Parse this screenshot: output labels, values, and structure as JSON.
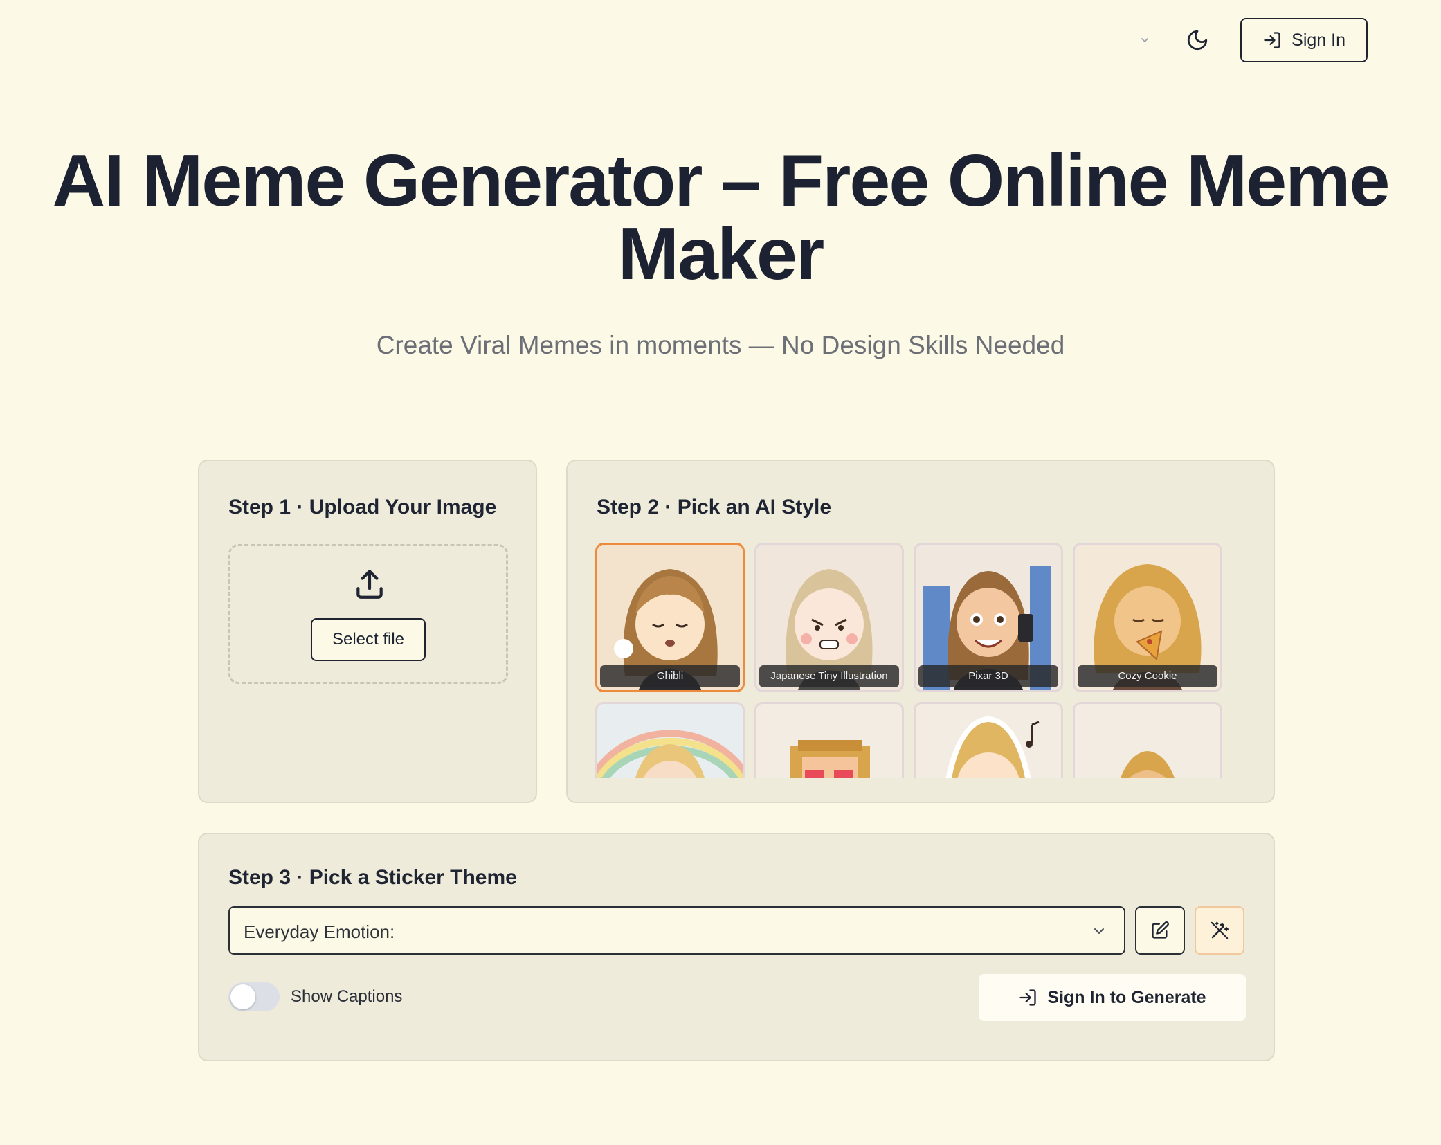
{
  "header": {
    "language_icon": "chevron-down-icon",
    "theme_icon": "moon-icon",
    "sign_in_label": "Sign In"
  },
  "hero": {
    "title": "AI Meme Generator – Free Online Meme Maker",
    "subtitle": "Create Viral Memes in moments — No Design Skills Needed"
  },
  "step1": {
    "title": "Step 1 · Upload Your Image",
    "select_file_label": "Select file"
  },
  "step2": {
    "title": "Step 2 · Pick an AI Style",
    "styles": [
      {
        "label": "Ghibli",
        "selected": true
      },
      {
        "label": "Japanese Tiny Illustration",
        "selected": false
      },
      {
        "label": "Pixar 3D",
        "selected": false
      },
      {
        "label": "Cozy Cookie",
        "selected": false
      },
      {
        "label": "",
        "selected": false
      },
      {
        "label": "",
        "selected": false
      },
      {
        "label": "",
        "selected": false
      },
      {
        "label": "",
        "selected": false
      }
    ]
  },
  "step3": {
    "title": "Step 3 · Pick a Sticker Theme",
    "theme_value": "Everyday Emotion:",
    "show_captions_label": "Show Captions",
    "show_captions_on": false,
    "generate_label": "Sign In to Generate"
  },
  "colors": {
    "page_bg": "#fcf9e7",
    "card_bg": "#efebdb",
    "accent_selected": "#ee8a3c",
    "text_dark": "#1e2432"
  }
}
